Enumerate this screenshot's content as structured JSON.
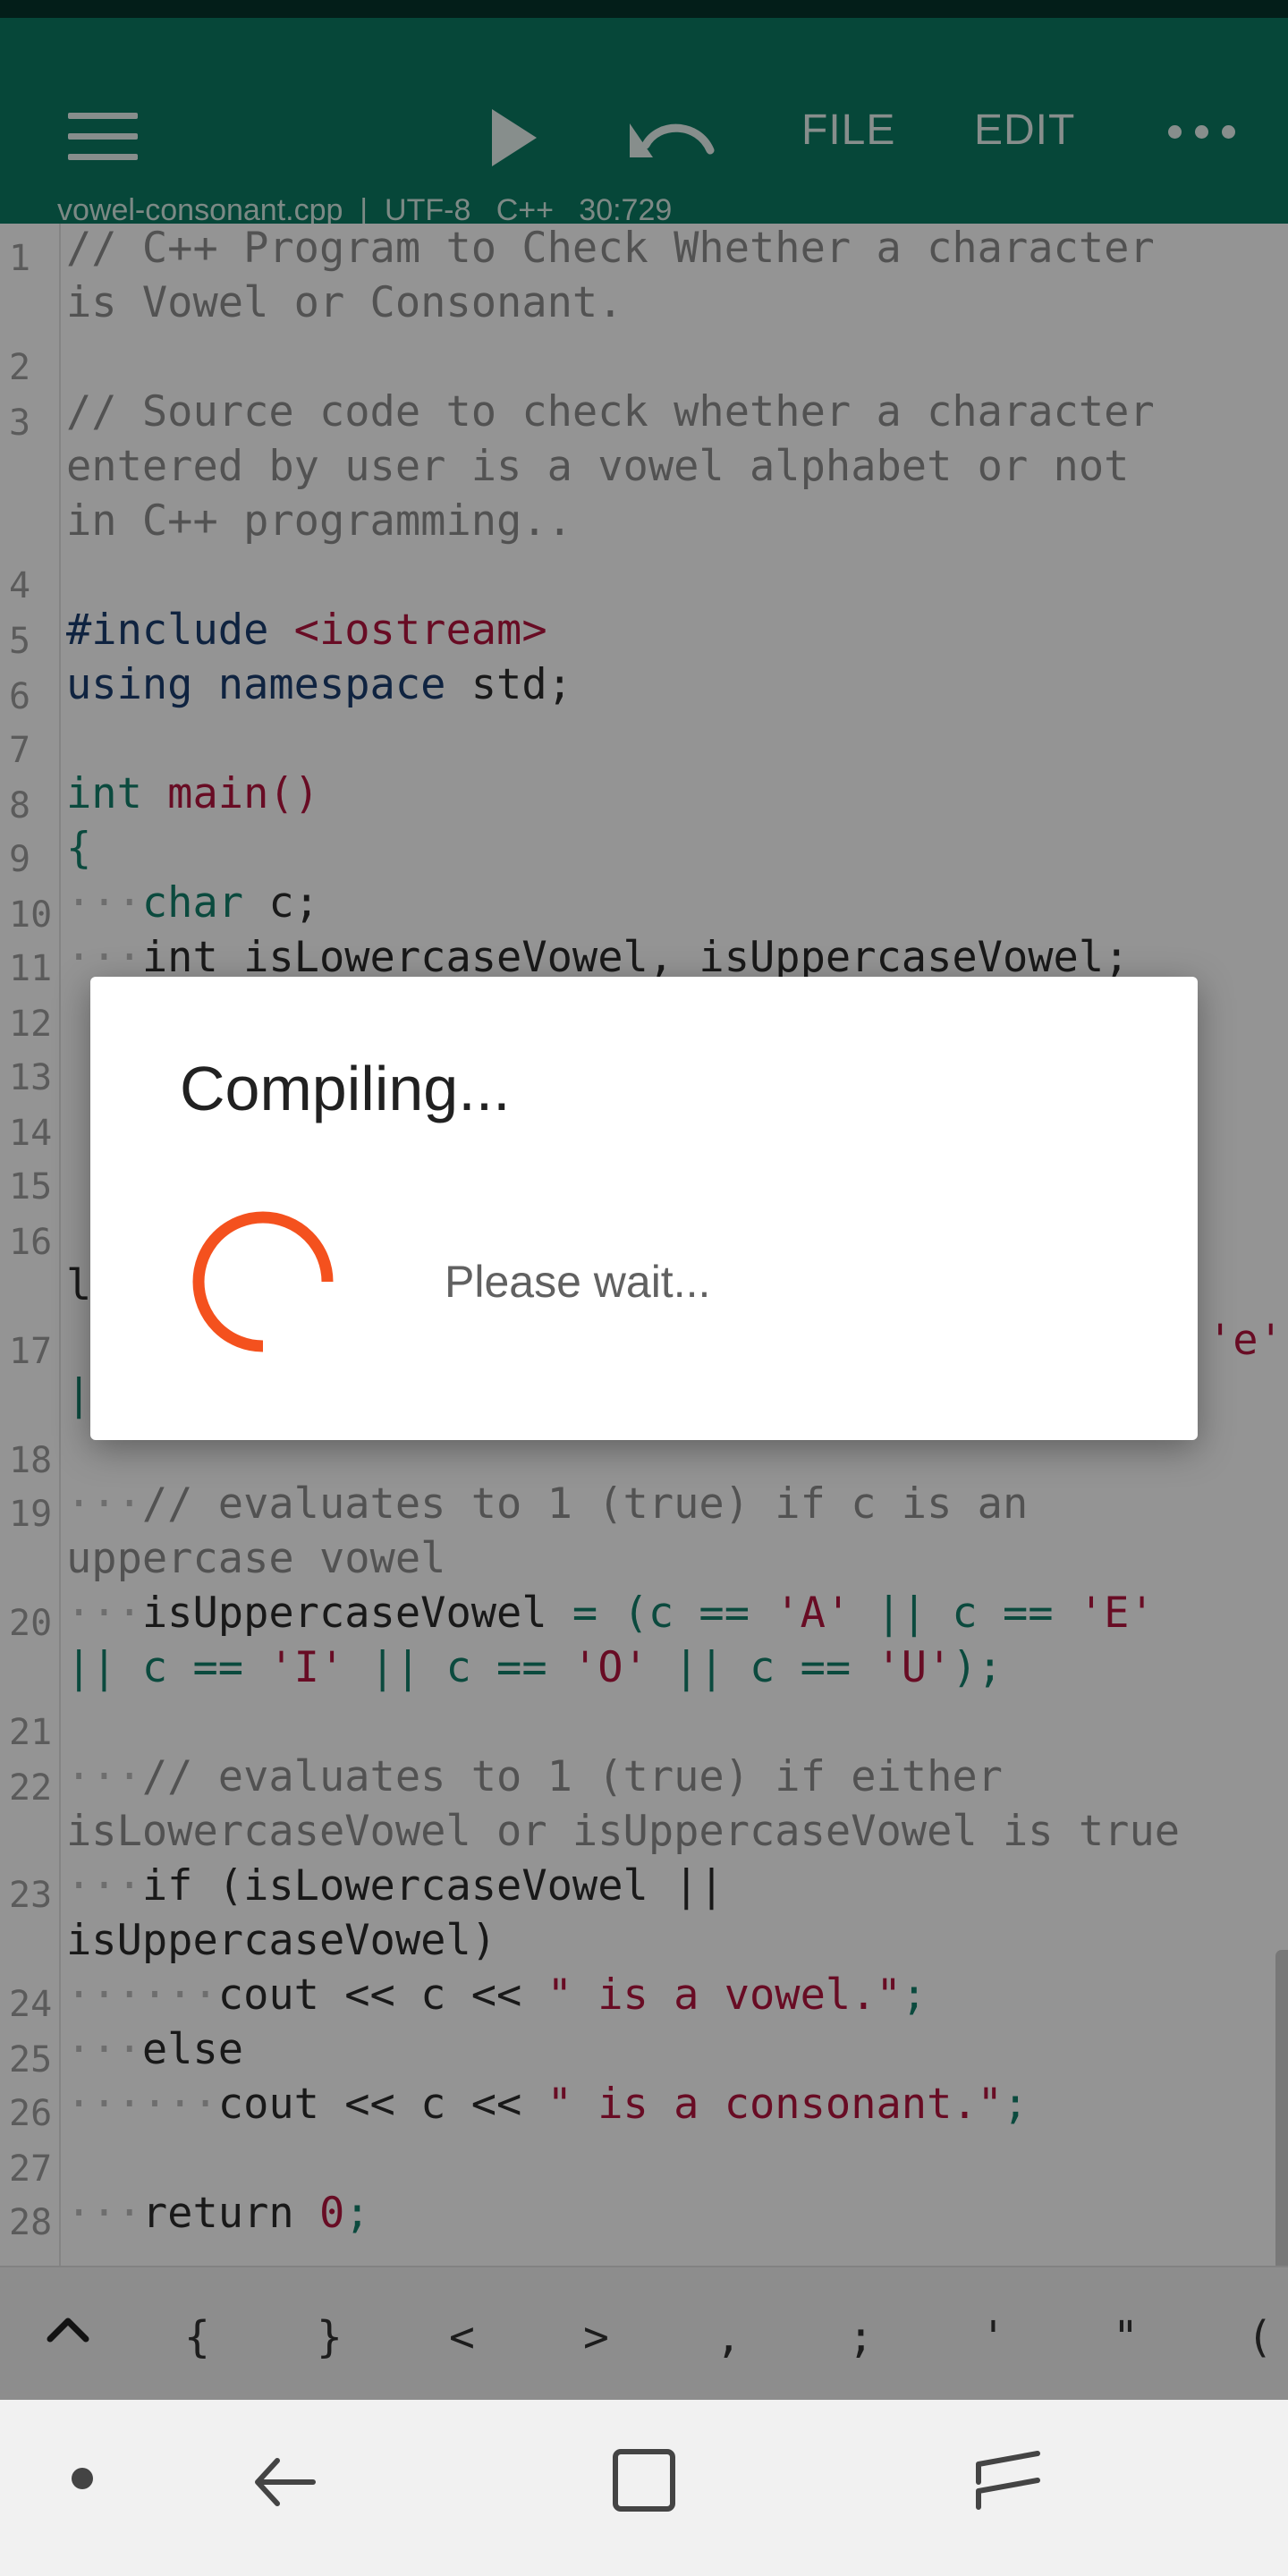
{
  "toolbar": {
    "file_label": "FILE",
    "edit_label": "EDIT",
    "file_info": "vowel-consonant.cpp  |  UTF-8   C++   30:729"
  },
  "editor": {
    "line_numbers": [
      "1",
      "2",
      "3",
      "4",
      "5",
      "6",
      "7",
      "8",
      "9",
      "10",
      "11",
      "12",
      "13",
      "14",
      "15",
      "16",
      "17",
      "18",
      "19",
      "20",
      "21",
      "22",
      "23",
      "24",
      "25",
      "26",
      "27",
      "28"
    ],
    "l1a": "// C++ Program to Check Whether a character",
    "l1b": "is Vowel or Consonant.",
    "l3a": "// Source code to check whether a character",
    "l3b": "entered by user is a vowel alphabet or not",
    "l3c": "in C++ programming..",
    "l5_kw": "#include",
    "l5_str": " <iostream>",
    "l6_a": "using namespace",
    "l6_b": " std;",
    "l8_kw": "int",
    "l8_fn": " main()",
    "l9": "{",
    "l10_kw": "char",
    "l10_b": " c;",
    "l11": "int isLowercaseVowel, isUppercaseVowel;",
    "l16_frag": "l",
    "l17_frag": "'e'",
    "l17b_frag": "|",
    "l19a": "// evaluates to 1 (true) if c is an",
    "l19b": "uppercase vowel",
    "l20a_1": "isUppercaseVowel",
    "l20a_2": " = (c == ",
    "l20a_3": "'A'",
    "l20a_4": " || c == ",
    "l20a_5": "'E'",
    "l20b_1": "|| c == ",
    "l20b_2": "'I'",
    "l20b_3": " || c == ",
    "l20b_4": "'O'",
    "l20b_5": " || c == ",
    "l20b_6": "'U'",
    "l20b_7": ");",
    "l22a": "// evaluates to 1 (true) if either",
    "l22b": "isLowercaseVowel or isUppercaseVowel is true",
    "l23a": "if (isLowercaseVowel ||",
    "l23b": "isUppercaseVowel)",
    "l24_1": "cout << c << ",
    "l24_2": "\" is a vowel.\"",
    "l24_3": ";",
    "l25": "else",
    "l26_1": "cout << c << ",
    "l26_2": "\" is a consonant.\"",
    "l26_3": ";",
    "l28_1": "return ",
    "l28_2": "0",
    "l28_3": ";"
  },
  "symbols": [
    "{",
    "}",
    "<",
    ">",
    ",",
    ";",
    "'",
    "\"",
    "("
  ],
  "dialog": {
    "title": "Compiling...",
    "message": "Please wait..."
  },
  "colors": {
    "toolbar": "#0b7a62",
    "spinner": "#f4511e"
  },
  "icons": {
    "menu": "hamburger-menu-icon",
    "run": "play-icon",
    "undo": "undo-icon",
    "more": "more-horizontal-icon",
    "spinner": "loading-spinner-icon"
  }
}
